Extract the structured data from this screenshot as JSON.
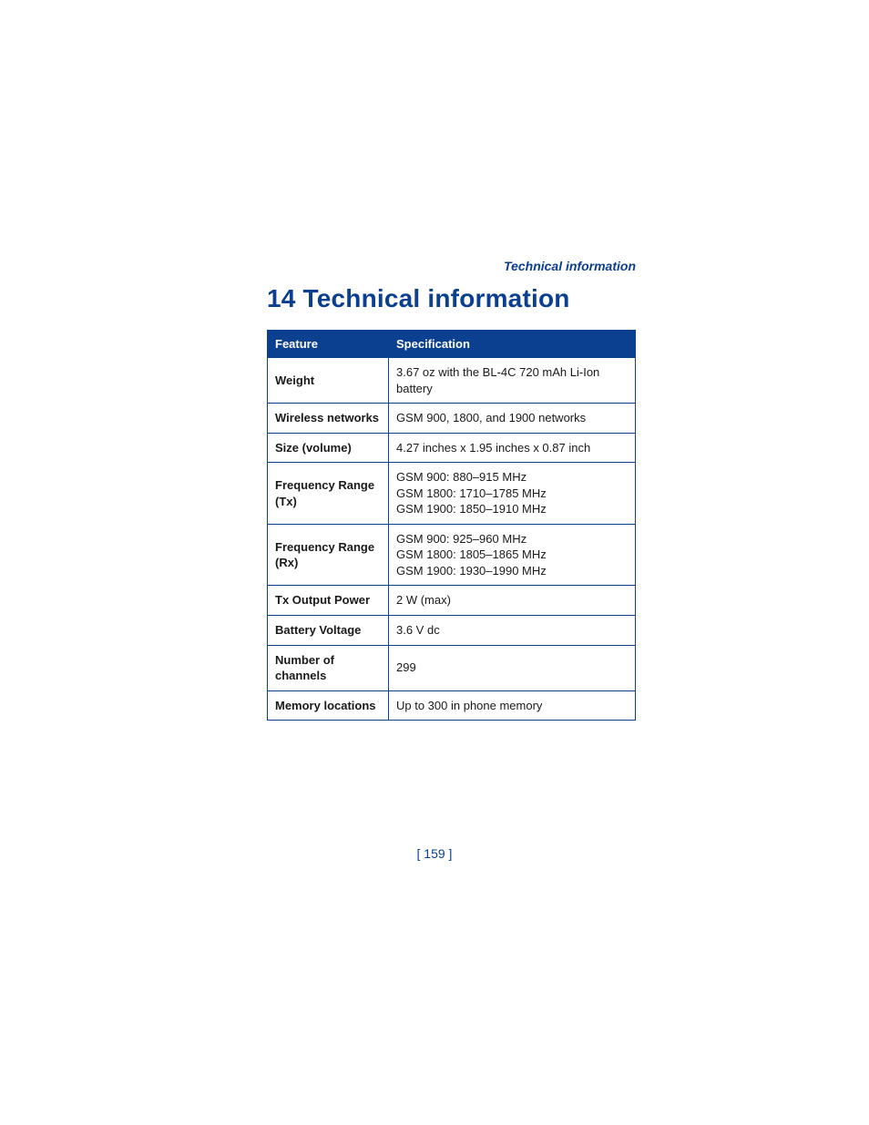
{
  "runningHeader": "Technical information",
  "chapterTitle": "14 Technical information",
  "table": {
    "headers": {
      "feature": "Feature",
      "spec": "Specification"
    },
    "rows": [
      {
        "feature": "Weight",
        "spec": "3.67 oz with the BL-4C 720 mAh Li-Ion battery"
      },
      {
        "feature": "Wireless networks",
        "spec": "GSM 900, 1800, and 1900 networks"
      },
      {
        "feature": "Size (volume)",
        "spec": "4.27 inches x 1.95 inches x 0.87 inch"
      },
      {
        "feature": "Frequency Range (Tx)",
        "spec": "GSM 900: 880–915 MHz\nGSM 1800: 1710–1785 MHz\nGSM 1900: 1850–1910 MHz"
      },
      {
        "feature": "Frequency Range (Rx)",
        "spec": "GSM 900: 925–960 MHz\nGSM 1800: 1805–1865 MHz\nGSM 1900: 1930–1990 MHz"
      },
      {
        "feature": "Tx Output Power",
        "spec": "2 W (max)"
      },
      {
        "feature": "Battery Voltage",
        "spec": "3.6 V dc"
      },
      {
        "feature": "Number of channels",
        "spec": "299"
      },
      {
        "feature": "Memory locations",
        "spec": "Up to 300 in phone memory"
      }
    ]
  },
  "pageNumber": "[ 159 ]"
}
